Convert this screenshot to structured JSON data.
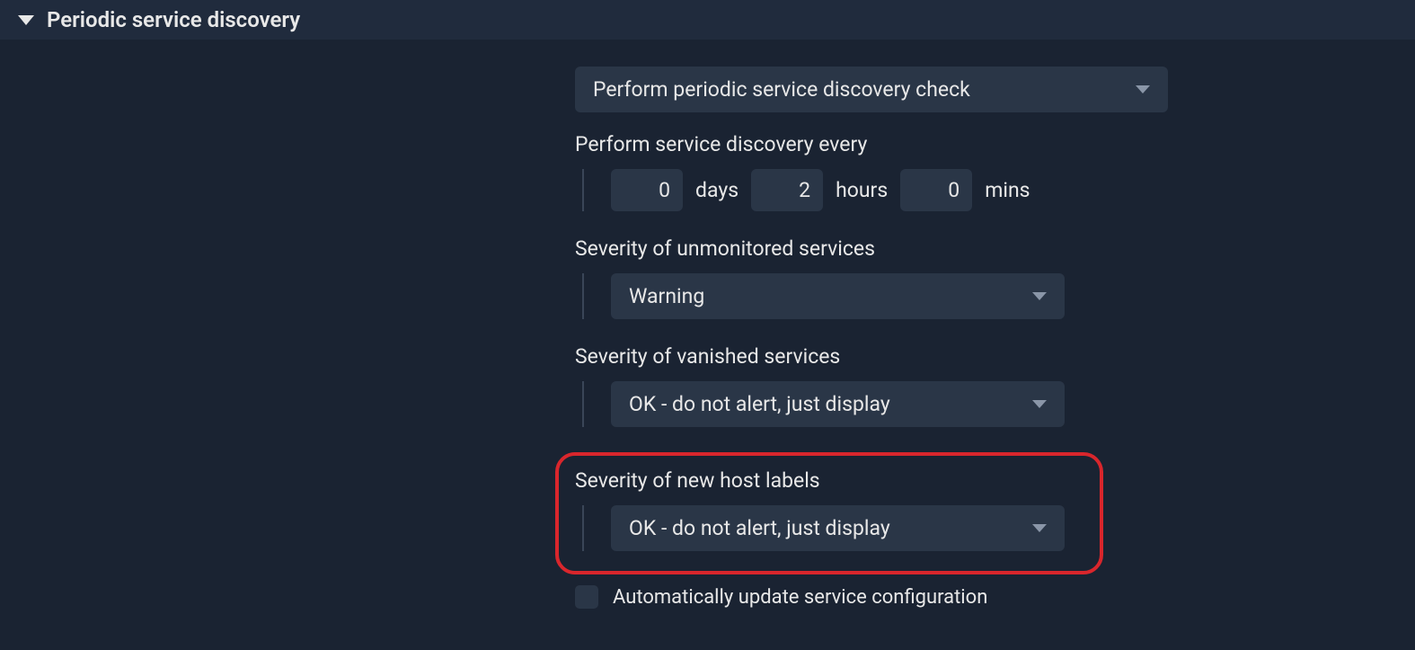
{
  "section": {
    "title": "Periodic service discovery"
  },
  "mode_dropdown": "Perform periodic service discovery check",
  "interval": {
    "label": "Perform service discovery every",
    "days": "0",
    "days_unit": "days",
    "hours": "2",
    "hours_unit": "hours",
    "mins": "0",
    "mins_unit": "mins"
  },
  "unmonitored": {
    "label": "Severity of unmonitored services",
    "value": "Warning"
  },
  "vanished": {
    "label": "Severity of vanished services",
    "value": "OK - do not alert, just display"
  },
  "newlabels": {
    "label": "Severity of new host labels",
    "value": "OK - do not alert, just display"
  },
  "autoupdate": {
    "label": "Automatically update service configuration"
  }
}
